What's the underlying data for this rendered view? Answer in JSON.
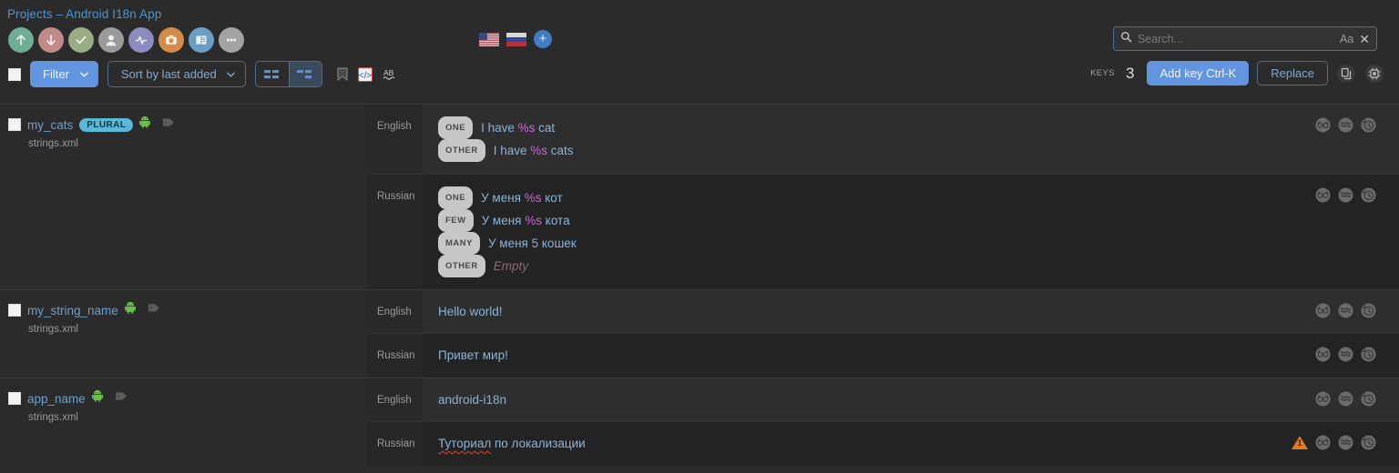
{
  "header": {
    "breadcrumb": "Projects – Android I18n App",
    "round_actions": [
      {
        "name": "upload-icon",
        "label": "Upload",
        "color": "#6fae94"
      },
      {
        "name": "download-icon",
        "label": "Download",
        "color": "#c08a8a"
      },
      {
        "name": "check-icon",
        "label": "Approve",
        "color": "#9aac86"
      },
      {
        "name": "person-icon",
        "label": "Contributors",
        "color": "#9a9a9a"
      },
      {
        "name": "activity-icon",
        "label": "Activity",
        "color": "#8b8cc0"
      },
      {
        "name": "camera-icon",
        "label": "Screenshots",
        "color": "#d18c4a"
      },
      {
        "name": "glossary-icon",
        "label": "Glossary",
        "color": "#6b9ec4"
      },
      {
        "name": "more-icon",
        "label": "More",
        "color": "#a3a3a3"
      }
    ],
    "languages": [
      {
        "name": "flag-us",
        "label": "English"
      },
      {
        "name": "flag-ru",
        "label": "Russian"
      }
    ],
    "add_language_label": "+",
    "search": {
      "placeholder": "Search...",
      "value": "",
      "match_case_label": "Aa",
      "clear_label": "✕"
    }
  },
  "toolbar": {
    "select_all_checked": false,
    "filter_label": "Filter",
    "sort_label": "Sort by last added",
    "caret": "⌄",
    "view_modes": [
      {
        "name": "view-mode-grid",
        "active": false
      },
      {
        "name": "view-mode-list",
        "active": true
      }
    ],
    "mini_icons": [
      {
        "name": "bookmark-icon",
        "label": "Bookmark"
      },
      {
        "name": "code-icon",
        "label": "Placeholders"
      },
      {
        "name": "spellcheck-icon",
        "label": "Spell check"
      }
    ],
    "keys_label": "KEYS",
    "keys_count": "3",
    "add_key_label": "Add key Ctrl-K",
    "replace_label": "Replace",
    "right_icons": [
      {
        "name": "copy-pages-icon",
        "label": "Copy"
      },
      {
        "name": "machine-translate-icon",
        "label": "Machine translation"
      }
    ]
  },
  "row_actions": [
    {
      "name": "proofread-icon",
      "label": "Proofread"
    },
    {
      "name": "machine-translate-row-icon",
      "label": "Machine translate"
    },
    {
      "name": "history-icon",
      "label": "History"
    }
  ],
  "warning": {
    "name": "warning-icon",
    "count": "1"
  },
  "keys": [
    {
      "name": "my_cats",
      "is_plural": true,
      "plural_badge": "PLURAL",
      "platform_icon": "android-icon",
      "tag_icon": "tag-icon",
      "file": "strings.xml",
      "checked": false,
      "translations": [
        {
          "language": "English",
          "shade": "light",
          "has_warning": false,
          "forms": [
            {
              "tag": "ONE",
              "parts": [
                {
                  "t": "I have ",
                  "k": "text"
                },
                {
                  "t": "%s",
                  "k": "placeholder"
                },
                {
                  "t": " cat",
                  "k": "text"
                }
              ]
            },
            {
              "tag": "OTHER",
              "parts": [
                {
                  "t": "I have ",
                  "k": "text"
                },
                {
                  "t": "%s",
                  "k": "placeholder"
                },
                {
                  "t": " cats",
                  "k": "text"
                }
              ]
            }
          ]
        },
        {
          "language": "Russian",
          "shade": "dark",
          "has_warning": false,
          "forms": [
            {
              "tag": "ONE",
              "parts": [
                {
                  "t": "У меня ",
                  "k": "text"
                },
                {
                  "t": "%s",
                  "k": "placeholder"
                },
                {
                  "t": " кот",
                  "k": "text"
                }
              ]
            },
            {
              "tag": "FEW",
              "parts": [
                {
                  "t": "У меня ",
                  "k": "text"
                },
                {
                  "t": "%s",
                  "k": "placeholder"
                },
                {
                  "t": " кота",
                  "k": "text"
                }
              ]
            },
            {
              "tag": "MANY",
              "parts": [
                {
                  "t": "У меня 5 кошек",
                  "k": "text"
                }
              ]
            },
            {
              "tag": "OTHER",
              "parts": [
                {
                  "t": "Empty",
                  "k": "empty"
                }
              ]
            }
          ]
        }
      ]
    },
    {
      "name": "my_string_name",
      "is_plural": false,
      "plural_badge": "",
      "platform_icon": "android-icon",
      "tag_icon": "tag-icon",
      "file": "strings.xml",
      "checked": false,
      "translations": [
        {
          "language": "English",
          "shade": "light",
          "has_warning": false,
          "forms": [
            {
              "tag": "",
              "parts": [
                {
                  "t": "Hello world!",
                  "k": "text"
                }
              ]
            }
          ]
        },
        {
          "language": "Russian",
          "shade": "dark",
          "has_warning": false,
          "forms": [
            {
              "tag": "",
              "parts": [
                {
                  "t": "Привет мир!",
                  "k": "text"
                }
              ]
            }
          ]
        }
      ]
    },
    {
      "name": "app_name",
      "is_plural": false,
      "plural_badge": "",
      "platform_icon": "android-icon",
      "tag_icon": "tag-icon",
      "file": "strings.xml",
      "checked": false,
      "translations": [
        {
          "language": "English",
          "shade": "light",
          "has_warning": false,
          "forms": [
            {
              "tag": "",
              "parts": [
                {
                  "t": "android-i18n",
                  "k": "text"
                }
              ]
            }
          ]
        },
        {
          "language": "Russian",
          "shade": "dark",
          "has_warning": true,
          "forms": [
            {
              "tag": "",
              "parts": [
                {
                  "t": "Туториал",
                  "k": "misspelled"
                },
                {
                  "t": " по локализации",
                  "k": "text"
                }
              ]
            }
          ]
        }
      ]
    }
  ],
  "colors": {
    "background": "#2b2b2b",
    "accent_blue": "#6295e0",
    "link_blue": "#6b9fd0",
    "value_blue": "#8ab4d8",
    "placeholder_magenta": "#c968d8",
    "plural_badge": "#5ab8d8",
    "warning_orange": "#e07b22",
    "spellcheck_red": "#d24a3a"
  }
}
